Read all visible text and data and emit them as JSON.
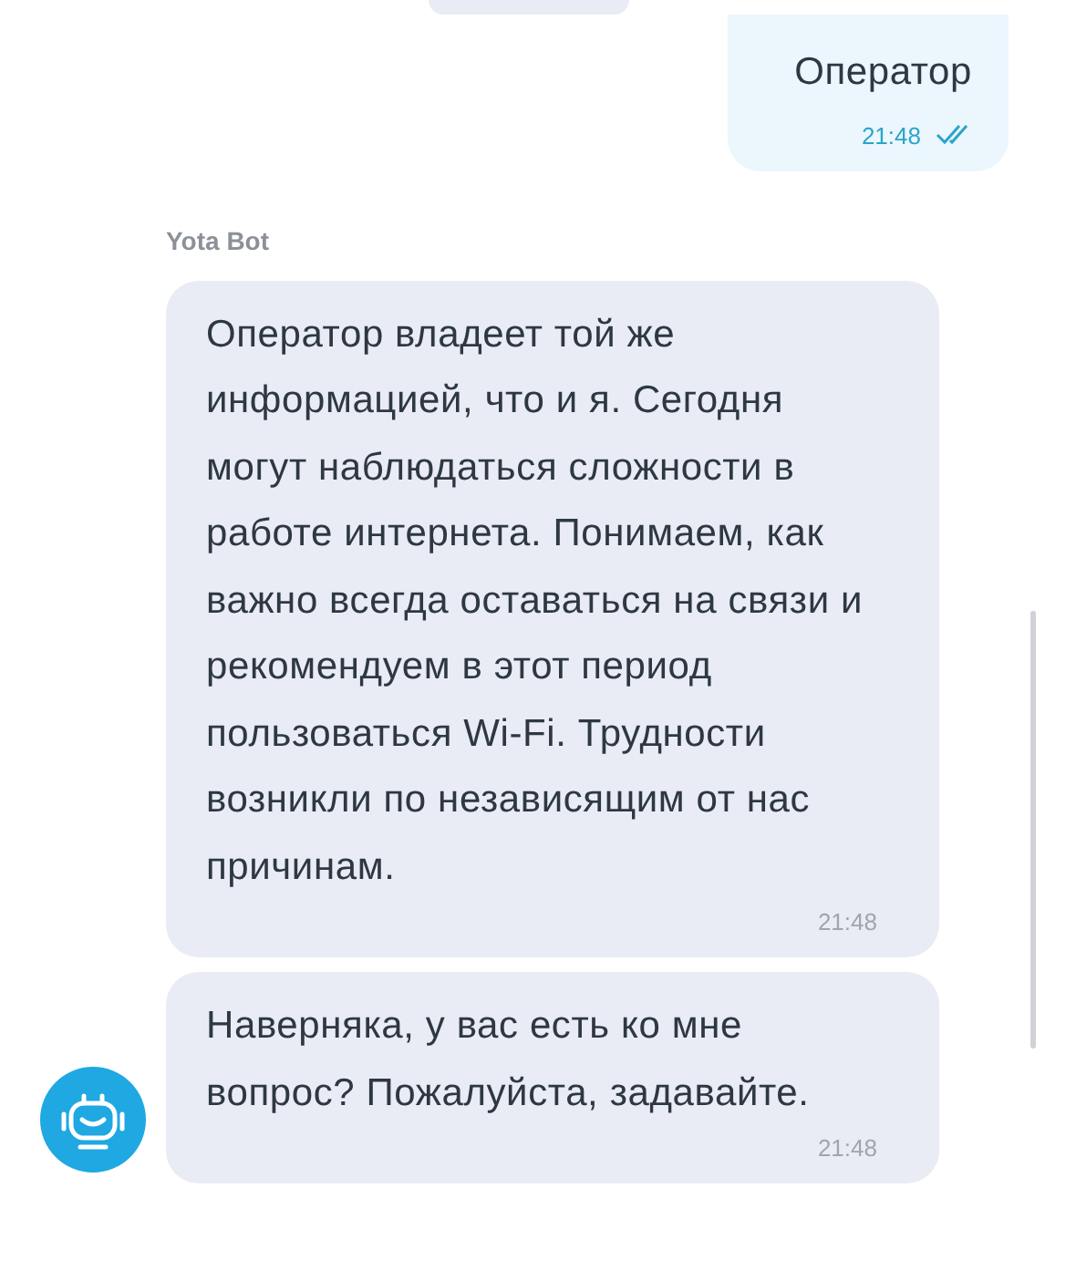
{
  "messages": [
    {
      "kind": "cut"
    },
    {
      "kind": "user",
      "text": "Оператор",
      "time": "21:48",
      "read": true
    },
    {
      "kind": "bot",
      "sender": "Yota Bot",
      "text": "Оператор владеет той же информацией, что и я. Сегодня могут наблюдаться сложности в работе интернета. Понимаем, как важно всегда оставаться на связи и рекомендуем в этот период пользоваться Wi-Fi. Трудности возникли по независящим от нас причинам.",
      "time": "21:48"
    },
    {
      "kind": "bot",
      "text": "Наверняка, у вас есть ко мне вопрос? Пожалуйста, задавайте.",
      "time": "21:48",
      "avatar": true
    }
  ]
}
